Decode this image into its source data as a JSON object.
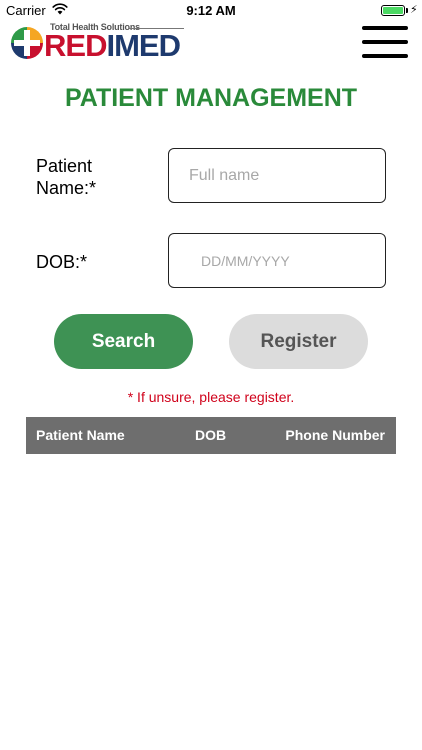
{
  "status_bar": {
    "carrier": "Carrier",
    "time": "9:12 AM",
    "battery_level": 1.0,
    "charging_icon": "bolt-icon",
    "wifi_icon": "wifi-icon"
  },
  "header": {
    "logo": {
      "tagline": "Total Health Solutions",
      "brand_prefix": "RED",
      "brand_suffix": "IMED"
    },
    "menu_icon": "hamburger-icon"
  },
  "page": {
    "title": "PATIENT MANAGEMENT"
  },
  "form": {
    "name_label": "Patient Name:*",
    "name_placeholder": "Full name",
    "name_value": "",
    "dob_label": "DOB:*",
    "dob_placeholder": "DD/MM/YYYY",
    "dob_value": "",
    "search_label": "Search",
    "register_label": "Register",
    "hint": "* If unsure, please register."
  },
  "table": {
    "columns": [
      "Patient Name",
      "DOB",
      "Phone Number"
    ],
    "rows": []
  },
  "colors": {
    "title_green": "#2a8a3a",
    "search_button": "#3e9254",
    "register_button": "#dcdcdc",
    "hint_red": "#d0021b",
    "table_header": "#6e6e6e",
    "brand_blue": "#1e3a6e",
    "brand_red": "#c8102e"
  }
}
